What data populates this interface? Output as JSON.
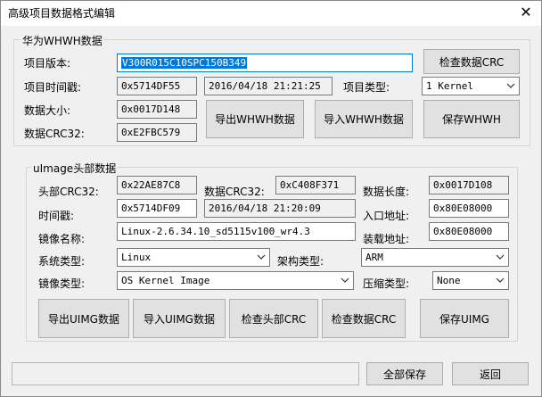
{
  "window": {
    "title": "高级项目数据格式编辑",
    "close_glyph": "✕"
  },
  "huawei": {
    "group_label": "华为WHWH数据",
    "labels": {
      "version": "项目版本:",
      "timestamp": "项目时间戳:",
      "data_size": "数据大小:",
      "data_crc": "数据CRC32:",
      "project_type": "项目类型:"
    },
    "version_value": "V300R015C10SPC150B349",
    "timestamp_hex": "0x5714DF55",
    "timestamp_text": "2016/04/18 21:21:25",
    "data_size_value": "0x0017D148",
    "data_crc_value": "0xE2FBC579",
    "project_type_value": "1 Kernel",
    "buttons": {
      "check_crc": "检查数据CRC",
      "export": "导出WHWH数据",
      "import": "导入WHWH数据",
      "save": "保存WHWH"
    }
  },
  "uimage": {
    "group_label": "uImage头部数据",
    "labels": {
      "header_crc": "头部CRC32:",
      "data_crc": "数据CRC32:",
      "data_len": "数据长度:",
      "timestamp": "时间戳:",
      "entry": "入口地址:",
      "image_name": "镜像名称:",
      "load": "装载地址:",
      "os_type": "系统类型:",
      "arch": "架构类型:",
      "image_type": "镜像类型:",
      "compress": "压缩类型:"
    },
    "header_crc_value": "0x22AE87C8",
    "data_crc_value": "0xC408F371",
    "data_len_value": "0x0017D108",
    "timestamp_hex": "0x5714DF09",
    "timestamp_text": "2016/04/18 21:20:09",
    "entry_value": "0x80E08000",
    "image_name_value": "Linux-2.6.34.10_sd5115v100_wr4.3",
    "load_value": "0x80E08000",
    "os_type_value": "Linux",
    "arch_value": "ARM",
    "image_type_value": "OS Kernel Image",
    "compress_value": "None",
    "buttons": {
      "export": "导出UIMG数据",
      "import": "导入UIMG数据",
      "check_header": "检查头部CRC",
      "check_data": "检查数据CRC",
      "save": "保存UIMG"
    }
  },
  "footer": {
    "save_all": "全部保存",
    "back": "返回"
  }
}
